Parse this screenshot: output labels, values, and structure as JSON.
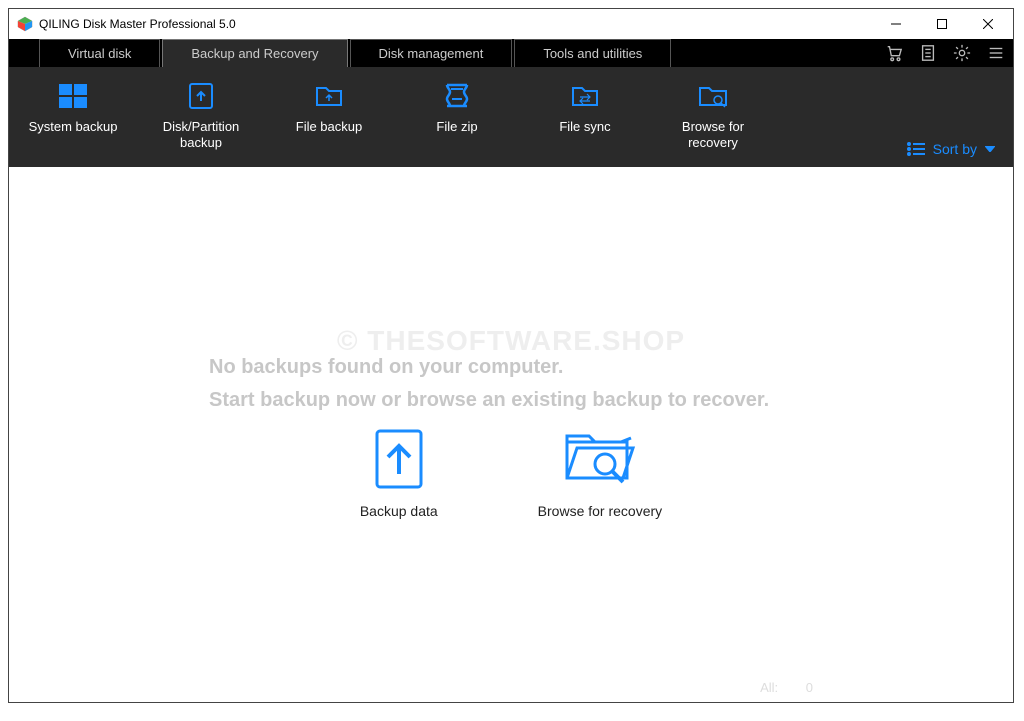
{
  "window": {
    "title": "QILING Disk Master Professional 5.0"
  },
  "tabs": {
    "virtual_disk": "Virtual disk",
    "backup_recovery": "Backup and Recovery",
    "disk_management": "Disk management",
    "tools_utilities": "Tools and utilities"
  },
  "toolbar": {
    "system_backup": "System backup",
    "disk_partition_backup": "Disk/Partition backup",
    "file_backup": "File backup",
    "file_zip": "File zip",
    "file_sync": "File sync",
    "browse_recovery": "Browse for recovery",
    "sort_by": "Sort by"
  },
  "content": {
    "watermark": "© THESOFTWARE.SHOP",
    "msg_line1": "No backups found on your computer.",
    "msg_line2": "Start backup now or browse an existing backup to recover.",
    "backup_data": "Backup data",
    "browse_recovery": "Browse for recovery"
  },
  "status": {
    "all_label": "All:",
    "all_count": "0"
  },
  "colors": {
    "accent": "#1a8cff",
    "dark": "#2a2a2a"
  }
}
